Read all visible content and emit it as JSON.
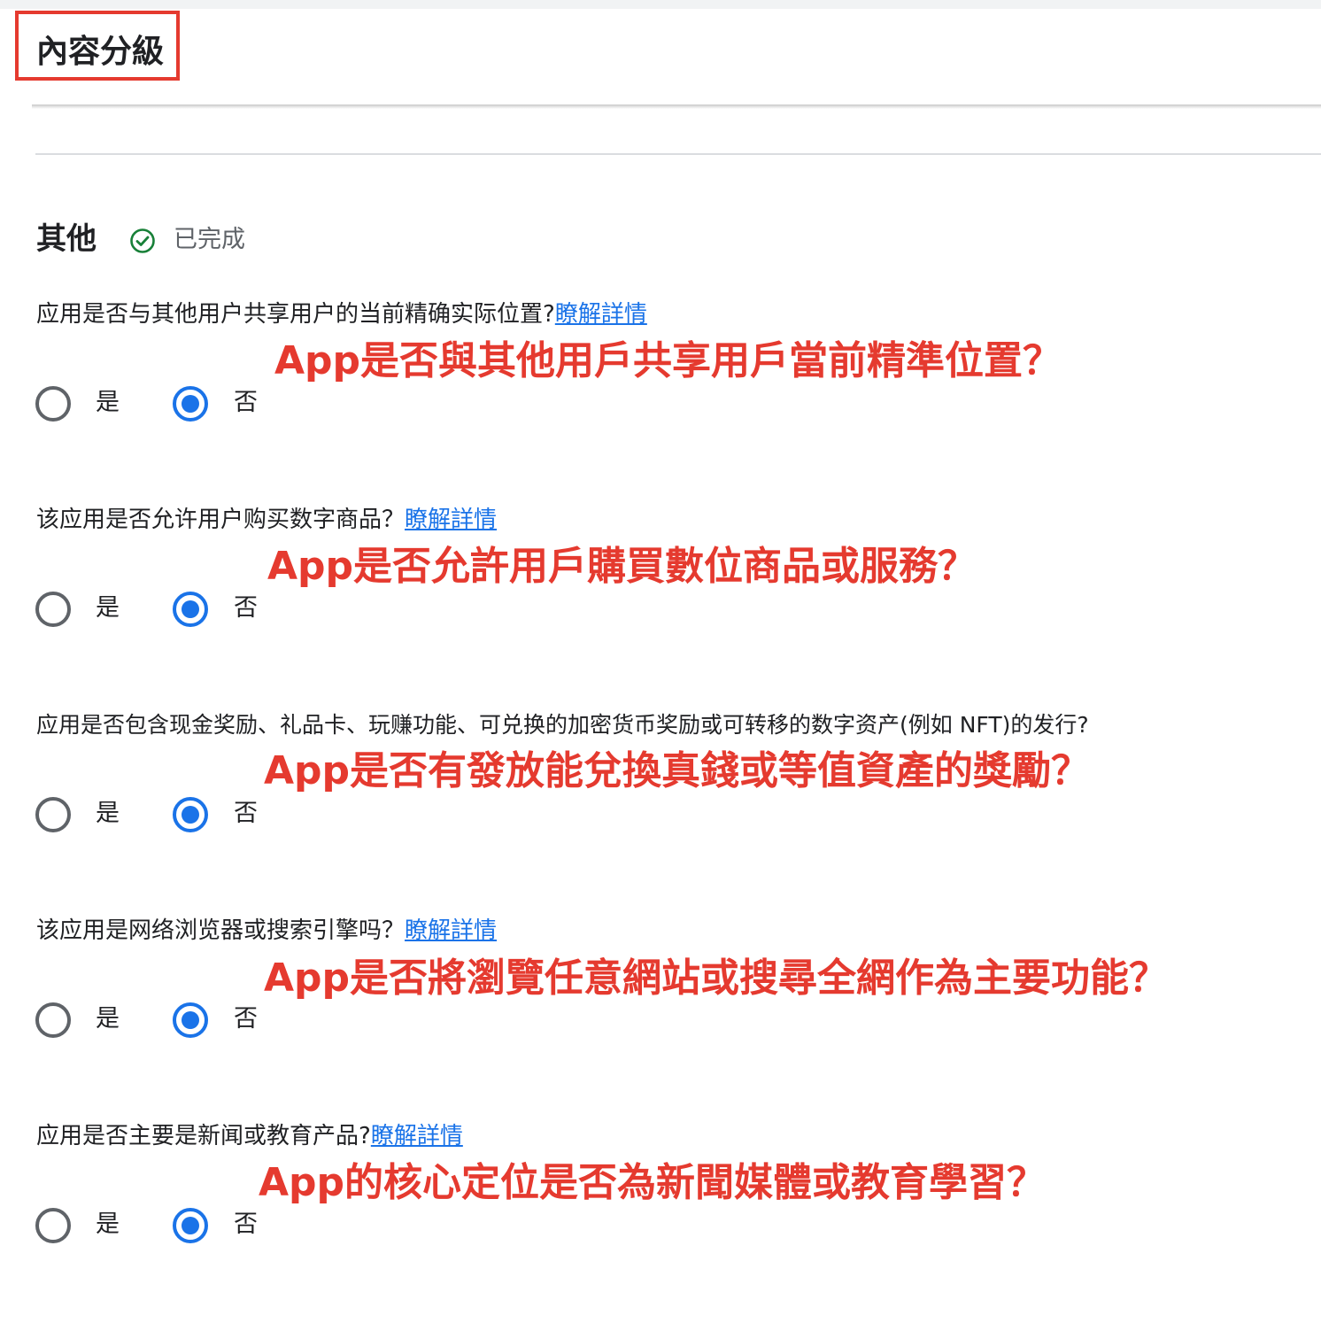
{
  "header": {
    "title": "內容分級"
  },
  "section": {
    "title": "其他",
    "status_text": "已完成",
    "status_icon": "check-circle-icon",
    "accent_color": "#1a73e8",
    "annotation_color": "#e53a2f"
  },
  "questions": [
    {
      "text": "应用是否与其他用户共享用户的当前精确实际位置?",
      "link": "瞭解詳情",
      "annotation": "App是否與其他用戶共享用戶當前精準位置？",
      "options": [
        "是",
        "否"
      ],
      "selected": "否"
    },
    {
      "text": "该应用是否允许用户购买数字商品？",
      "link": "瞭解詳情",
      "annotation": "App是否允許用戶購買數位商品或服務？",
      "options": [
        "是",
        "否"
      ],
      "selected": "否"
    },
    {
      "text": "应用是否包含现金奖励、礼品卡、玩赚功能、可兑换的加密货币奖励或可转移的数字资产(例如 NFT)的发行?",
      "link": "",
      "annotation": "App是否有發放能兌換真錢或等值資產的獎勵？",
      "options": [
        "是",
        "否"
      ],
      "selected": "否"
    },
    {
      "text": "该应用是网络浏览器或搜索引擎吗？",
      "link": "瞭解詳情",
      "annotation": "App是否將瀏覽任意網站或搜尋全網作為主要功能？",
      "options": [
        "是",
        "否"
      ],
      "selected": "否"
    },
    {
      "text": "应用是否主要是新闻或教育产品?",
      "link": "瞭解詳情",
      "annotation": "App的核心定位是否為新聞媒體或教育學習？",
      "options": [
        "是",
        "否"
      ],
      "selected": "否"
    }
  ]
}
